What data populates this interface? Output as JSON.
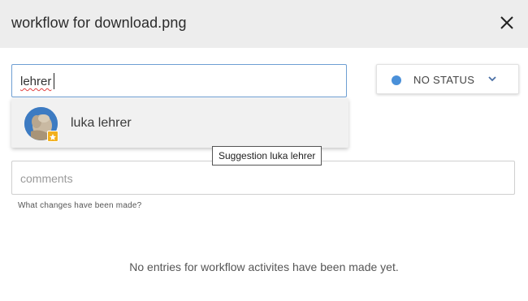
{
  "dialog": {
    "title": "workflow for download.png"
  },
  "search": {
    "value": "lehrer"
  },
  "status": {
    "label": "NO STATUS",
    "dot_color": "#4a90d9",
    "chevron_icon": "chevron-down-icon"
  },
  "suggestions": [
    {
      "name": "luka lehrer",
      "badge_icon": "star-badge-icon"
    }
  ],
  "tooltip": {
    "text": "Suggestion luka lehrer"
  },
  "comments": {
    "placeholder": "comments",
    "helper": "What changes have been made?"
  },
  "workflow": {
    "empty_message": "No entries for workflow activites have been made yet."
  }
}
